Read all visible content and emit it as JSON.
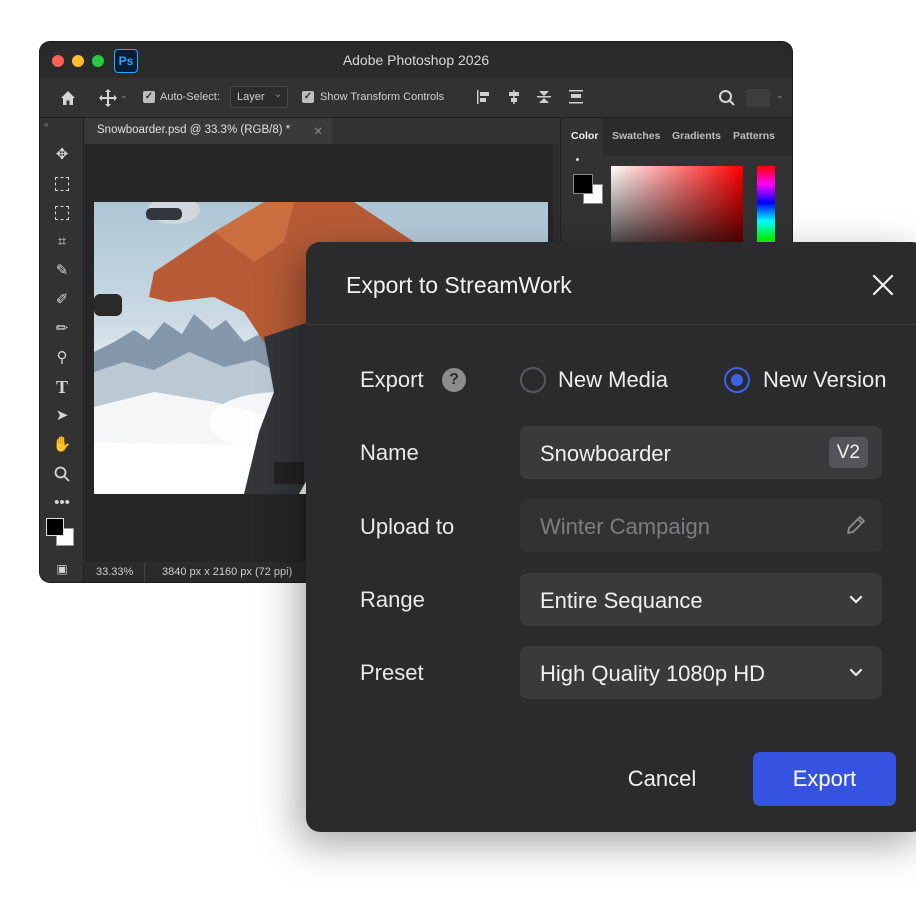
{
  "photoshop": {
    "title": "Adobe Photoshop 2026",
    "logo_text": "Ps",
    "options": {
      "auto_select_label": "Auto-Select:",
      "auto_select_value": "Layer",
      "transform_label": "Show Transform Controls"
    },
    "doc_tab": "Snowboarder.psd @ 33.3% (RGB/8) *",
    "status": {
      "zoom": "33.33%",
      "dimensions": "3840 px x 2160 px (72 ppi)"
    },
    "panel_tabs": [
      "Color",
      "Swatches",
      "Gradients",
      "Patterns"
    ]
  },
  "dialog": {
    "title": "Export to StreamWork",
    "export_label": "Export",
    "help_symbol": "?",
    "options": [
      "New Media",
      "New Version"
    ],
    "selected_option": "New Version",
    "name_label": "Name",
    "name_value": "Snowboarder",
    "version_badge": "V2",
    "upload_label": "Upload to",
    "upload_placeholder": "Winter Campaign",
    "range_label": "Range",
    "range_value": "Entire Sequance",
    "preset_label": "Preset",
    "preset_value": "High Quality 1080p HD",
    "cancel_label": "Cancel",
    "export_button_label": "Export"
  },
  "colors": {
    "accent": "#3552e0",
    "dialog_bg": "#2b2b2d",
    "field_bg": "#3a3a3d"
  }
}
